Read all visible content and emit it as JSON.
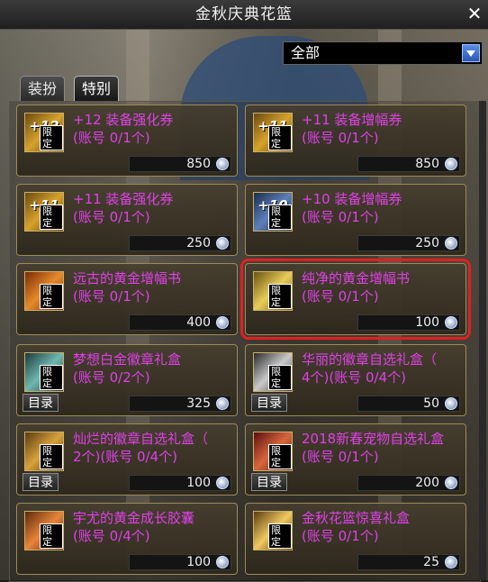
{
  "window": {
    "title": "金秋庆典花篮",
    "close_symbol": "✕"
  },
  "filter": {
    "selected": "全部"
  },
  "tabs": [
    {
      "label": "装扮",
      "active": false
    },
    {
      "label": "特别",
      "active": true
    }
  ],
  "items": [
    {
      "icon_label": "+12",
      "icon": "ticket-icon",
      "badge": "限定",
      "name": "+12 装备强化券",
      "limit": "(账号 0/1个)",
      "price": "850",
      "catalog": null,
      "selected": false
    },
    {
      "icon_label": "+11",
      "icon": "ticket-icon",
      "badge": "限定",
      "name": "+11 装备增幅券",
      "limit": "(账号 0/1个)",
      "price": "850",
      "catalog": null,
      "selected": false
    },
    {
      "icon_label": "+11",
      "icon": "ticket-icon",
      "badge": "限定",
      "name": "+11 装备强化券",
      "limit": "(账号 0/1个)",
      "price": "250",
      "catalog": null,
      "selected": false
    },
    {
      "icon_label": "+10",
      "icon": "ticket-icon",
      "badge": "限定",
      "name": "+10 装备增幅券",
      "limit": "(账号 0/1个)",
      "price": "250",
      "catalog": null,
      "selected": false
    },
    {
      "icon_label": "",
      "icon": "book-icon",
      "badge": "限定",
      "name": "远古的黄金增幅书",
      "limit": "(账号 0/1个)",
      "price": "400",
      "catalog": null,
      "selected": false
    },
    {
      "icon_label": "",
      "icon": "book-icon",
      "badge": "限定",
      "name": "纯净的黄金增幅书",
      "limit": "(账号 0/1个)",
      "price": "100",
      "catalog": null,
      "selected": true
    },
    {
      "icon_label": "",
      "icon": "emblem-icon",
      "badge": "限定",
      "name": "梦想白金徽章礼盒",
      "limit": "(账号 0/2个)",
      "price": "325",
      "catalog": "目录",
      "selected": false
    },
    {
      "icon_label": "",
      "icon": "emblem-icon",
      "badge": "限定",
      "name": "华丽的徽章自选礼盒（",
      "limit": "4个)(账号 0/4个)",
      "price": "50",
      "catalog": "目录",
      "selected": false
    },
    {
      "icon_label": "",
      "icon": "box-icon",
      "badge": "限定",
      "name": "灿烂的徽章自选礼盒（",
      "limit": "2个)(账号 0/4个)",
      "price": "100",
      "catalog": "目录",
      "selected": false
    },
    {
      "icon_label": "",
      "icon": "box-icon",
      "badge": "限定",
      "name": "2018新春宠物自选礼盒",
      "limit": "(账号 0/1个)",
      "price": "200",
      "catalog": "目录",
      "selected": false
    },
    {
      "icon_label": "",
      "icon": "bag-icon",
      "badge": "限定",
      "name": "宇尤的黄金成长胶囊",
      "limit": "(账号 0/4个)",
      "price": "100",
      "catalog": null,
      "selected": false
    },
    {
      "icon_label": "",
      "icon": "basket-icon",
      "badge": "限定",
      "name": "金秋花篮惊喜礼盒",
      "limit": "(账号 0/1个)",
      "price": "25",
      "catalog": null,
      "selected": false
    }
  ],
  "colors": {
    "item_name": "#e040e8",
    "highlight": "#e02020",
    "dropdown_arrow": "#2a55b0"
  }
}
